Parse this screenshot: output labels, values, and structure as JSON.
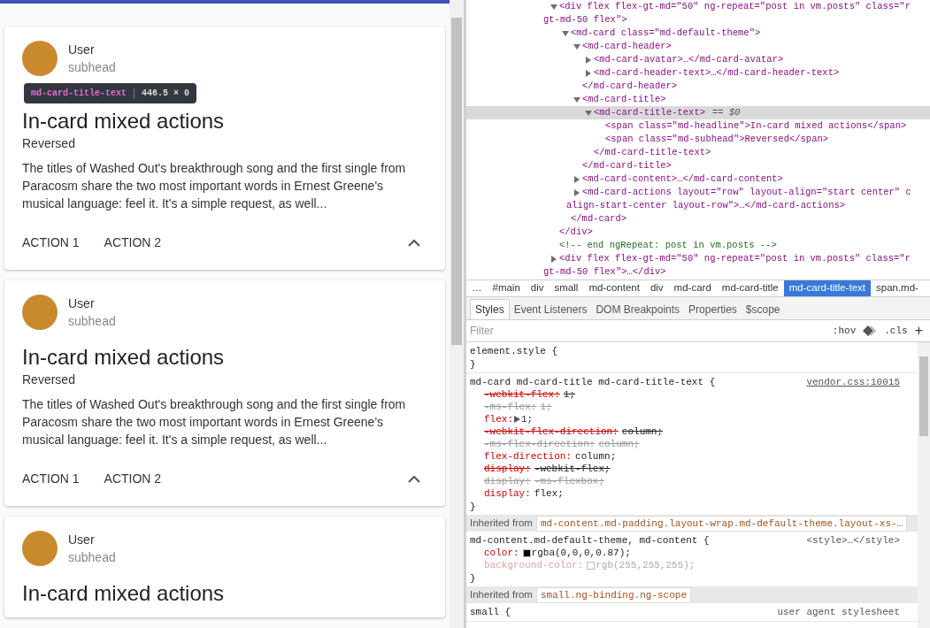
{
  "page": {
    "cards": [
      {
        "user": "User",
        "subhead": "subhead",
        "title": "In-card mixed actions",
        "subtitle": "Reversed",
        "body": "The titles of Washed Out's breakthrough song and the first single from Paracosm share the two most important words in Ernest Greene's musical language: feel it. It's a simple request, as well...",
        "actions": [
          "ACTION 1",
          "ACTION 2"
        ],
        "tooltip": {
          "element": "md-card-title-text",
          "size": "446.5 × 0"
        }
      },
      {
        "user": "User",
        "subhead": "subhead",
        "title": "In-card mixed actions",
        "subtitle": "Reversed",
        "body": "The titles of Washed Out's breakthrough song and the first single from Paracosm share the two most important words in Ernest Greene's musical language: feel it. It's a simple request, as well...",
        "actions": [
          "ACTION 1",
          "ACTION 2"
        ]
      },
      {
        "user": "User",
        "subhead": "subhead",
        "title": "In-card mixed actions"
      }
    ]
  },
  "devtools": {
    "dom_tree": [
      {
        "kind": "element",
        "expanded": true,
        "selected": false,
        "lines": [
          "<div flex flex-gt-md=\"50\" ng-repeat=\"post in vm.posts\" class=\"r",
          "gt-md-50 flex\">"
        ],
        "closing": "</div>",
        "children": [
          {
            "kind": "element",
            "expanded": true,
            "selected": false,
            "lines": [
              "<md-card class=\"md-default-theme\">"
            ],
            "closing": "</md-card>",
            "children": [
              {
                "kind": "element",
                "expanded": true,
                "selected": false,
                "lines": [
                  "<md-card-header>"
                ],
                "closing": "</md-card-header>",
                "children": [
                  {
                    "kind": "element",
                    "expanded": false,
                    "selected": false,
                    "lines": [
                      "<md-card-avatar>…</md-card-avatar>"
                    ]
                  },
                  {
                    "kind": "element",
                    "expanded": false,
                    "selected": false,
                    "lines": [
                      "<md-card-header-text>…</md-card-header-text>"
                    ]
                  }
                ]
              },
              {
                "kind": "element",
                "expanded": true,
                "selected": false,
                "lines": [
                  "<md-card-title>"
                ],
                "closing": "</md-card-title>",
                "children": [
                  {
                    "kind": "element",
                    "expanded": true,
                    "selected": true,
                    "lines": [
                      "<md-card-title-text>"
                    ],
                    "marker": "== $0",
                    "closing": "</md-card-title-text>",
                    "children": [
                      {
                        "kind": "leaf",
                        "selected": false,
                        "lines": [
                          "<span class=\"md-headline\">In-card mixed actions</span>"
                        ]
                      },
                      {
                        "kind": "leaf",
                        "selected": false,
                        "lines": [
                          "<span class=\"md-subhead\">Reversed</span>"
                        ]
                      }
                    ]
                  }
                ]
              },
              {
                "kind": "element",
                "expanded": false,
                "selected": false,
                "lines": [
                  "<md-card-content>…</md-card-content>"
                ]
              },
              {
                "kind": "element",
                "expanded": false,
                "selected": false,
                "lines": [
                  "<md-card-actions layout=\"row\" layout-align=\"start center\" c",
                  "align-start-center layout-row\">…</md-card-actions>"
                ]
              }
            ]
          }
        ]
      },
      {
        "kind": "comment",
        "selected": false,
        "lines": [
          "<!-- end ngRepeat: post in vm.posts -->"
        ]
      },
      {
        "kind": "element",
        "expanded": false,
        "selected": false,
        "lines": [
          "<div flex flex-gt-md=\"50\" ng-repeat=\"post in vm.posts\" class=\"r",
          "gt-md-50 flex\">…</div>"
        ]
      }
    ],
    "breadcrumbs": [
      {
        "label": "…",
        "selected": false
      },
      {
        "label": "#main",
        "selected": false
      },
      {
        "label": "div",
        "selected": false
      },
      {
        "label": "small",
        "selected": false
      },
      {
        "label": "md-content",
        "selected": false
      },
      {
        "label": "div",
        "selected": false
      },
      {
        "label": "md-card",
        "selected": false
      },
      {
        "label": "md-card-title",
        "selected": false
      },
      {
        "label": "md-card-title-text",
        "selected": true
      },
      {
        "label": "span.md-",
        "selected": false
      }
    ],
    "tabs": [
      {
        "label": "Styles",
        "selected": true
      },
      {
        "label": "Event Listeners",
        "selected": false
      },
      {
        "label": "DOM Breakpoints",
        "selected": false
      },
      {
        "label": "Properties",
        "selected": false
      },
      {
        "label": "$scope",
        "selected": false
      }
    ],
    "filter": {
      "placeholder": "Filter",
      "hov": ":hov",
      "cls": ".cls",
      "add": "+"
    },
    "styles": [
      {
        "kind": "rule",
        "selector": "element.style {",
        "close": "}"
      },
      {
        "kind": "rule",
        "selector": "md-card md-card-title md-card-title-text {",
        "source": "vendor.css:10015",
        "close": "}",
        "declarations": [
          {
            "name": "-webkit-flex:",
            "value": "1;",
            "struck": true,
            "faded": false,
            "shorthand": false
          },
          {
            "name": "-ms-flex:",
            "value": "1;",
            "struck": true,
            "faded": true,
            "shorthand": false
          },
          {
            "name": "flex:",
            "value": "1;",
            "struck": false,
            "faded": false,
            "shorthand": true
          },
          {
            "name": "-webkit-flex-direction:",
            "value": "column;",
            "struck": true,
            "faded": false,
            "shorthand": false
          },
          {
            "name": "-ms-flex-direction:",
            "value": "column;",
            "struck": true,
            "faded": true,
            "shorthand": false
          },
          {
            "name": "flex-direction:",
            "value": "column;",
            "struck": false,
            "faded": false,
            "shorthand": false
          },
          {
            "name": "display:",
            "value": "-webkit-flex;",
            "struck": true,
            "faded": false,
            "shorthand": false
          },
          {
            "name": "display:",
            "value": "-ms-flexbox;",
            "struck": true,
            "faded": true,
            "shorthand": false
          },
          {
            "name": "display:",
            "value": "flex;",
            "struck": false,
            "faded": false,
            "shorthand": false
          }
        ]
      },
      {
        "kind": "inherited",
        "label": "Inherited from",
        "from": "md-content.md-padding.layout-wrap.md-default-theme.layout-xs-…"
      },
      {
        "kind": "rule",
        "selector": "md-content.md-default-theme, md-content {",
        "source": "<style>…</style>",
        "close": "}",
        "declarations": [
          {
            "name": "color:",
            "value": "rgba(0,0,0,0.87);",
            "struck": false,
            "faded": false,
            "shorthand": false,
            "color": "#000000"
          },
          {
            "name": "background-color:",
            "value": "rgb(255,255,255);",
            "struck": false,
            "faded": true,
            "shorthand": false,
            "color": "#ffffff"
          }
        ]
      },
      {
        "kind": "inherited",
        "label": "Inherited from",
        "from": "small.ng-binding.ng-scope"
      },
      {
        "kind": "rule",
        "selector": "small {",
        "source": "user agent stylesheet"
      }
    ]
  }
}
